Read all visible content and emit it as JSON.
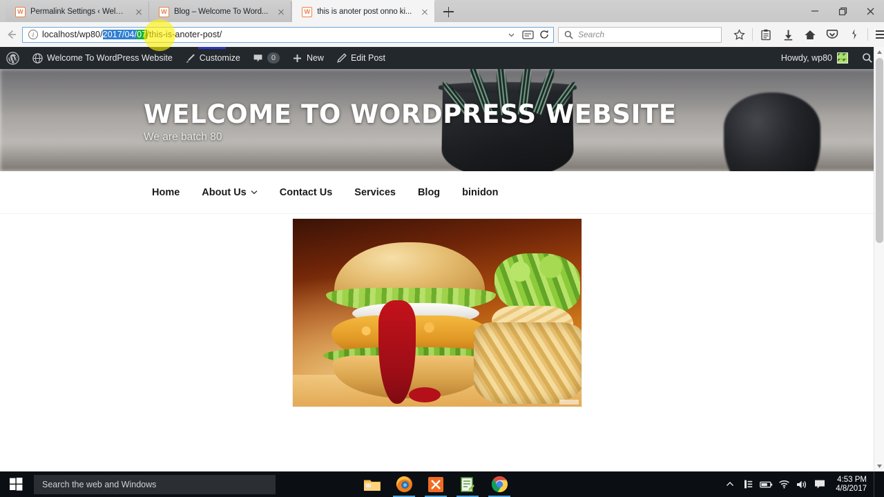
{
  "browser": {
    "tabs": [
      {
        "title": "Permalink Settings ‹ Welc...",
        "favicon": "wordpress-favicon",
        "active": false
      },
      {
        "title": "Blog – Welcome To Word...",
        "favicon": "wordpress-favicon",
        "active": false
      },
      {
        "title": "this is anoter post onno ki...",
        "favicon": "wordpress-favicon",
        "active": true
      }
    ],
    "new_tab_label": "+",
    "window_controls": {
      "minimize": "–",
      "restore": "❐",
      "close": "✕"
    },
    "url": {
      "prefix": "localhost/wp80/",
      "selected_blue": "2017/04/",
      "selected_green": "07",
      "suffix": "/this-is-anoter-post/"
    },
    "search": {
      "placeholder": "Search"
    },
    "toolbar_icons": [
      "bookmark-star-icon",
      "library-icon",
      "downloads-icon",
      "home-icon",
      "pocket-icon",
      "sync-icon",
      "menu-icon"
    ]
  },
  "adminbar": {
    "logo": "wordpress-logo",
    "site_name": "Welcome To WordPress Website",
    "customize": "Customize",
    "comments_count": "0",
    "new": "New",
    "edit_post": "Edit Post",
    "howdy": "Howdy, wp80",
    "search_icon": "search-icon"
  },
  "site": {
    "title": "WELCOME TO WORDPRESS WEBSITE",
    "tagline": "We are batch 80",
    "nav": [
      {
        "label": "Home",
        "has_dropdown": false
      },
      {
        "label": "About Us",
        "has_dropdown": true
      },
      {
        "label": "Contact Us",
        "has_dropdown": false
      },
      {
        "label": "Services",
        "has_dropdown": false
      },
      {
        "label": "Blog",
        "has_dropdown": false
      },
      {
        "label": "binidon",
        "has_dropdown": false
      }
    ],
    "post_image_alt": "burger-and-fries-photo"
  },
  "taskbar": {
    "start_label": "start-button",
    "search_placeholder": "Search the web and Windows",
    "apps": [
      {
        "name": "file-explorer-icon"
      },
      {
        "name": "firefox-icon"
      },
      {
        "name": "xampp-icon"
      },
      {
        "name": "notepad-plus-plus-icon"
      },
      {
        "name": "chrome-icon"
      }
    ],
    "tray_icons": [
      "show-hidden-icons",
      "app-tray-icon",
      "battery-icon",
      "wifi-icon",
      "volume-icon",
      "action-center-icon"
    ],
    "time": "4:53 PM",
    "date": "4/8/2017"
  },
  "colors": {
    "adminbar_bg": "#23282d",
    "accent_blue": "#2f7fd2",
    "accent_green": "#14b332",
    "highlight_yellow": "#fff200",
    "taskbar_bg": "#0b0f14"
  }
}
